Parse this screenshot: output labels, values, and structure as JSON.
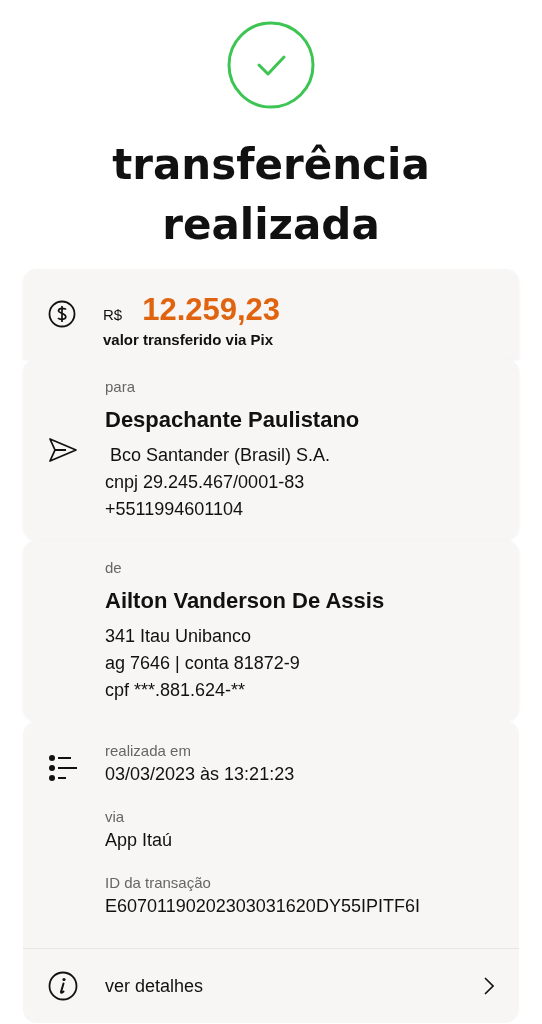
{
  "title": "transferência realizada",
  "amount": {
    "currency": "R$",
    "value": "12.259,23",
    "caption": "valor transferido via Pix"
  },
  "sections": [
    {
      "kind": "recipient",
      "label": "para",
      "name": "Despachante Paulistano",
      "lines": [
        " Bco Santander (Brasil) S.A.",
        "cnpj 29.245.467/0001-83",
        "+5511994601104"
      ]
    },
    {
      "kind": "sender",
      "label": "de",
      "name": "Ailton Vanderson De Assis",
      "lines": [
        "341 Itau Unibanco",
        "ag 7646 | conta 81872-9",
        "cpf ***.881.624-**"
      ]
    }
  ],
  "details": {
    "fields": [
      {
        "label": "realizada em",
        "value": "03/03/2023 às 13:21:23"
      },
      {
        "label": "via",
        "value": "App Itaú"
      },
      {
        "label": "ID da transação",
        "value": "E60701190202303031620DY55IPITF6I"
      }
    ]
  },
  "more": {
    "label": "ver detalhes"
  }
}
